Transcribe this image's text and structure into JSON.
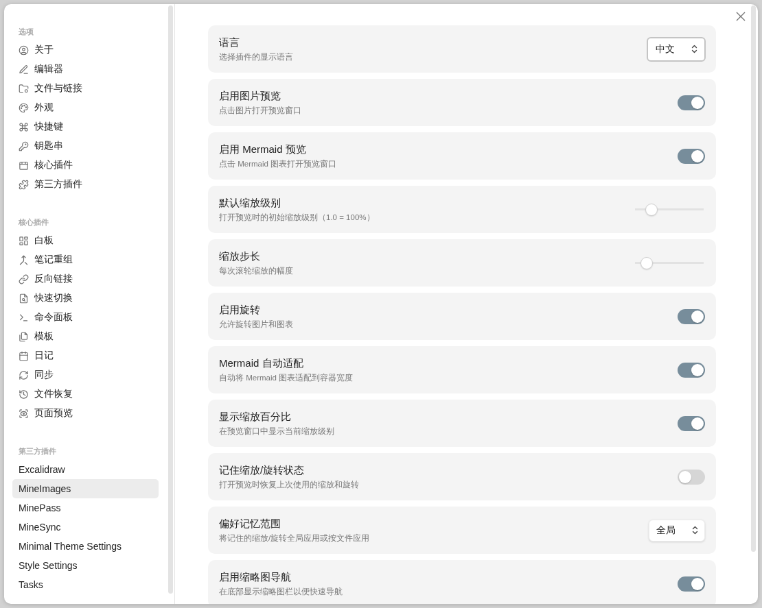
{
  "sidebar": {
    "sections": [
      {
        "heading": "选项",
        "items": [
          {
            "label": "关于",
            "selected": false
          },
          {
            "label": "编辑器",
            "selected": false
          },
          {
            "label": "文件与链接",
            "selected": false
          },
          {
            "label": "外观",
            "selected": false
          },
          {
            "label": "快捷键",
            "selected": false
          },
          {
            "label": "钥匙串",
            "selected": false
          },
          {
            "label": "核心插件",
            "selected": false
          },
          {
            "label": "第三方插件",
            "selected": false
          }
        ]
      },
      {
        "heading": "核心插件",
        "items": [
          {
            "label": "白板",
            "selected": false
          },
          {
            "label": "笔记重组",
            "selected": false
          },
          {
            "label": "反向链接",
            "selected": false
          },
          {
            "label": "快速切换",
            "selected": false
          },
          {
            "label": "命令面板",
            "selected": false
          },
          {
            "label": "模板",
            "selected": false
          },
          {
            "label": "日记",
            "selected": false
          },
          {
            "label": "同步",
            "selected": false
          },
          {
            "label": "文件恢复",
            "selected": false
          },
          {
            "label": "页面预览",
            "selected": false
          }
        ]
      },
      {
        "heading": "第三方插件",
        "items": [
          {
            "label": "Excalidraw",
            "selected": false
          },
          {
            "label": "MineImages",
            "selected": true
          },
          {
            "label": "MinePass",
            "selected": false
          },
          {
            "label": "MineSync",
            "selected": false
          },
          {
            "label": "Minimal Theme Settings",
            "selected": false
          },
          {
            "label": "Style Settings",
            "selected": false
          },
          {
            "label": "Tasks",
            "selected": false
          }
        ]
      }
    ]
  },
  "settings": [
    {
      "kind": "dropdown",
      "title": "语言",
      "description": "选择插件的显示语言",
      "value": "中文",
      "focused": true
    },
    {
      "kind": "toggle",
      "title": "启用图片预览",
      "description": "点击图片打开预览窗口",
      "on": true
    },
    {
      "kind": "toggle",
      "title": "启用 Mermaid 预览",
      "description": "点击 Mermaid 图表打开预览窗口",
      "on": true
    },
    {
      "kind": "slider",
      "title": "默认缩放级别",
      "description": "打开预览时的初始缩放级别（1.0 = 100%）",
      "level": 0.18
    },
    {
      "kind": "slider",
      "title": "缩放步长",
      "description": "每次滚轮缩放的幅度",
      "level": 0.1
    },
    {
      "kind": "toggle",
      "title": "启用旋转",
      "description": "允许旋转图片和图表",
      "on": true
    },
    {
      "kind": "toggle",
      "title": "Mermaid 自动适配",
      "description": "自动将 Mermaid 图表适配到容器宽度",
      "on": true
    },
    {
      "kind": "toggle",
      "title": "显示缩放百分比",
      "description": "在预览窗口中显示当前缩放级别",
      "on": true
    },
    {
      "kind": "toggle",
      "title": "记住缩放/旋转状态",
      "description": "打开预览时恢复上次使用的缩放和旋转",
      "on": false
    },
    {
      "kind": "dropdown",
      "title": "偏好记忆范围",
      "description": "将记住的缩放/旋转全局应用或按文件应用",
      "value": "全局",
      "focused": false
    },
    {
      "kind": "toggle",
      "title": "启用缩略图导航",
      "description": "在底部显示缩略图栏以便快速导航",
      "on": true
    }
  ]
}
